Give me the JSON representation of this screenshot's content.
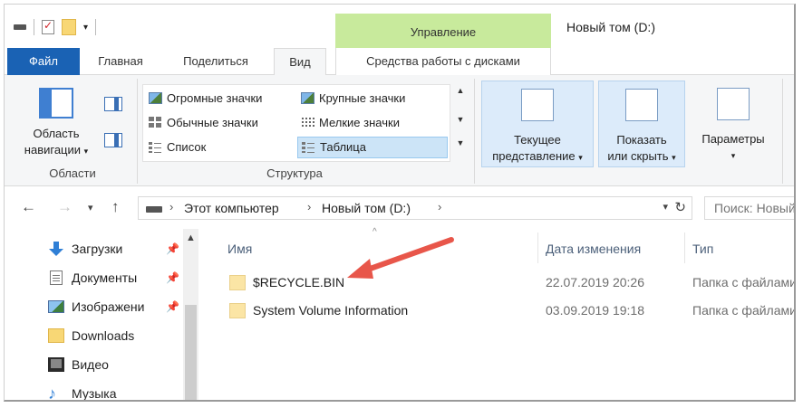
{
  "quick_access": {
    "icons": [
      "drive-icon",
      "properties-icon",
      "new-folder-icon",
      "customize-arrow-icon"
    ]
  },
  "window": {
    "title": "Новый том (D:)",
    "contextual_tab_group": "Управление"
  },
  "ribbon_tabs": [
    {
      "label": "Файл",
      "active": false
    },
    {
      "label": "Главная",
      "active": false
    },
    {
      "label": "Поделиться",
      "active": false
    },
    {
      "label": "Вид",
      "active": true
    },
    {
      "label": "Средства работы с дисками",
      "active": false
    }
  ],
  "ribbon": {
    "panes_group": {
      "nav_pane_label_line1": "Область",
      "nav_pane_label_line2": "навигации",
      "group_label": "Области"
    },
    "layout_group": {
      "items": [
        {
          "label": "Огромные значки",
          "icon": "extra-large-icons-icon",
          "selected": false
        },
        {
          "label": "Крупные значки",
          "icon": "large-icons-icon",
          "selected": false
        },
        {
          "label": "Обычные значки",
          "icon": "medium-icons-icon",
          "selected": false
        },
        {
          "label": "Мелкие значки",
          "icon": "small-icons-icon",
          "selected": false
        },
        {
          "label": "Список",
          "icon": "list-icon",
          "selected": false
        },
        {
          "label": "Таблица",
          "icon": "details-icon",
          "selected": true
        }
      ],
      "group_label": "Структура"
    },
    "current_view": {
      "line1": "Текущее",
      "line2": "представление"
    },
    "show_hide": {
      "line1": "Показать",
      "line2": "или скрыть"
    },
    "options": {
      "label": "Параметры"
    }
  },
  "address_bar": {
    "breadcrumbs": [
      "Этот компьютер",
      "Новый том (D:)"
    ],
    "search_placeholder": "Поиск: Новый том (D:)"
  },
  "nav_pane": {
    "items": [
      {
        "label": "Загрузки",
        "icon": "downloads-icon",
        "pinned": true
      },
      {
        "label": "Документы",
        "icon": "documents-icon",
        "pinned": true
      },
      {
        "label": "Изображени",
        "icon": "pictures-icon",
        "pinned": true
      },
      {
        "label": "Downloads",
        "icon": "folder-icon",
        "pinned": false
      },
      {
        "label": "Видео",
        "icon": "video-icon",
        "pinned": false
      },
      {
        "label": "Музыка",
        "icon": "music-icon",
        "pinned": false
      }
    ]
  },
  "file_list": {
    "columns": [
      "Имя",
      "Дата изменения",
      "Тип"
    ],
    "rows": [
      {
        "name": "$RECYCLE.BIN",
        "date": "22.07.2019 20:26",
        "type": "Папка с файлами"
      },
      {
        "name": "System Volume Information",
        "date": "03.09.2019 19:18",
        "type": "Папка с файлами"
      }
    ]
  },
  "colors": {
    "file_tab": "#1a62b4",
    "manage_tab": "#c8ea9c",
    "annotation_arrow": "#e8564a",
    "selection": "#cce4f7"
  }
}
